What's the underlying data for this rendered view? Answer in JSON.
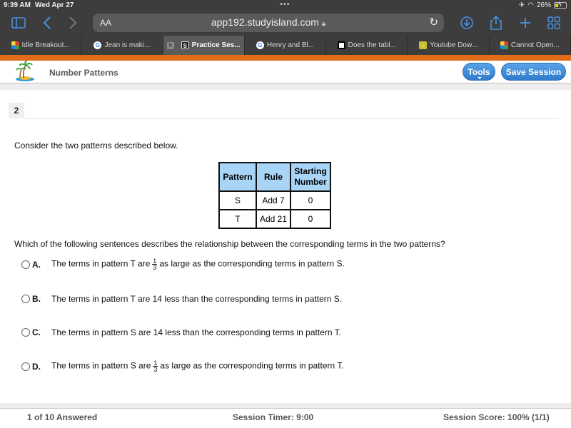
{
  "status_bar": {
    "time": "9:39 AM",
    "date": "Wed Apr 27",
    "battery": "26%",
    "battery_level": 0.26
  },
  "browser": {
    "text_size_label": "AA",
    "url": "app192.studyisland.com",
    "icons": [
      "sidebar-icon",
      "back-icon",
      "forward-icon",
      "lock-icon",
      "reload-icon",
      "download-icon",
      "share-icon",
      "new-tab-icon",
      "tab-overview-icon"
    ]
  },
  "tabs": [
    {
      "label": "Idle Breakout...",
      "favicon": "multi",
      "active": false
    },
    {
      "label": "Jean is maki...",
      "favicon": "g",
      "active": false
    },
    {
      "label": "Practice Ses...",
      "favicon": "s",
      "active": true
    },
    {
      "label": "Henry and Bl...",
      "favicon": "g",
      "active": false
    },
    {
      "label": "Does the tabl...",
      "favicon": "sq",
      "active": false
    },
    {
      "label": "Youtube Dow...",
      "favicon": "yt",
      "active": false
    },
    {
      "label": "Cannot Open...",
      "favicon": "multi",
      "active": false
    }
  ],
  "header": {
    "title": "Number Patterns",
    "tools_label": "Tools",
    "save_label": "Save Session"
  },
  "question": {
    "number": "2",
    "prompt": "Consider the two patterns described below.",
    "table": {
      "headers": [
        "Pattern",
        "Rule",
        "Starting Number"
      ],
      "rows": [
        [
          "S",
          "Add 7",
          "0"
        ],
        [
          "T",
          "Add 21",
          "0"
        ]
      ]
    },
    "text": "Which of the following sentences describes the relationship between the corresponding terms in the two patterns?",
    "choices": [
      {
        "letter": "A.",
        "before": "The terms in pattern T are",
        "frac_num": "1",
        "frac_den": "3",
        "after": "as large as the corresponding terms in pattern S."
      },
      {
        "letter": "B.",
        "text": "The terms in pattern T are 14 less than the corresponding terms in pattern S."
      },
      {
        "letter": "C.",
        "text": "The terms in pattern S are 14 less than the corresponding terms in pattern T."
      },
      {
        "letter": "D.",
        "before": "The terms in pattern S are",
        "frac_num": "1",
        "frac_den": "3",
        "after": "as large as the corresponding terms in pattern T."
      }
    ]
  },
  "footer": {
    "answered": "1 of 10 Answered",
    "timer": "Session Timer: 9:00",
    "score": "Session Score: 100% (1/1)"
  },
  "colors": {
    "accent_orange": "#e06c1a",
    "button_blue": "#2f7bcc",
    "table_header": "#a8d4f5",
    "browser_chrome": "#3d3d3d"
  }
}
